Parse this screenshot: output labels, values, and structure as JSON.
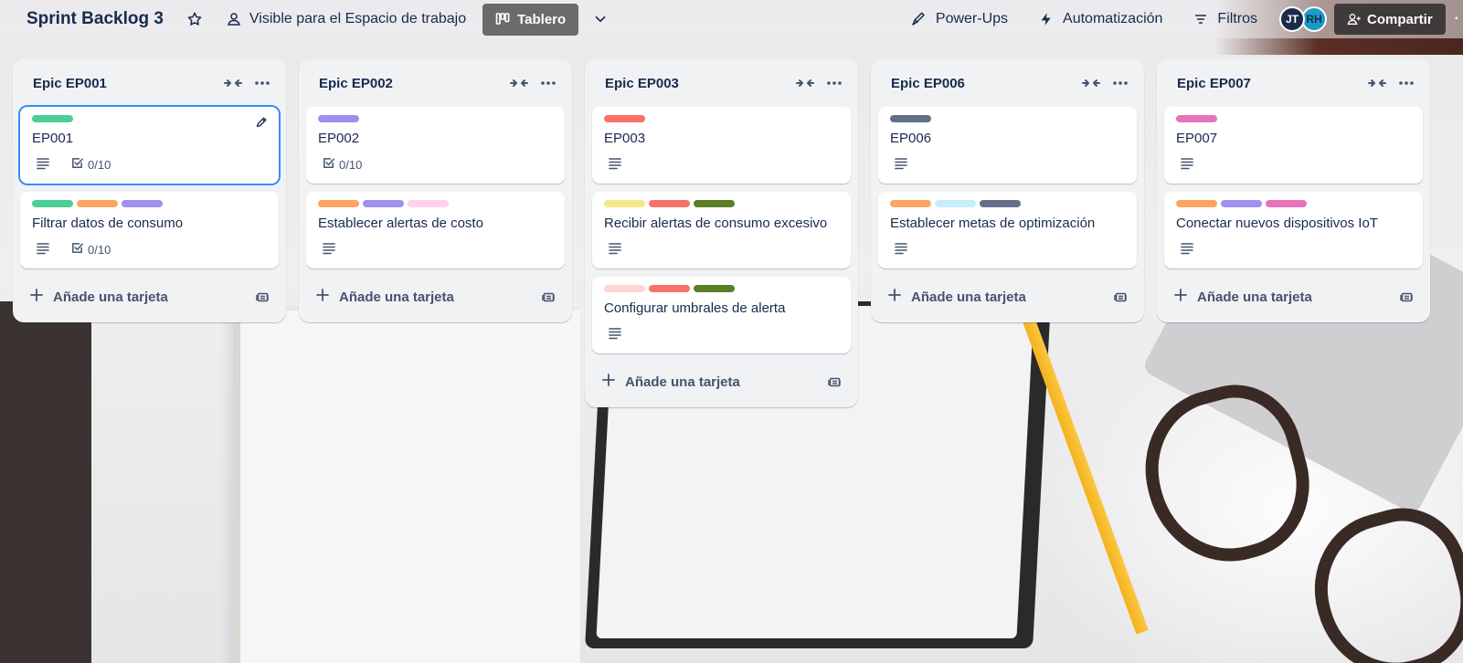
{
  "header": {
    "board_title": "Sprint Backlog 3",
    "visibility_label": "Visible para el Espacio de trabajo",
    "view_label": "Tablero",
    "powerups_label": "Power-Ups",
    "automation_label": "Automatización",
    "filters_label": "Filtros",
    "members": [
      {
        "initials": "JT",
        "color": "#1d2b4a"
      },
      {
        "initials": "RH",
        "color": "#1b9ac8"
      }
    ],
    "share_label": "Compartir"
  },
  "colors": {
    "green": "#4bce97",
    "orange": "#fea362",
    "purple": "#9f8fef",
    "pink_light": "#fdd0ec",
    "red": "#f87168",
    "slate": "#626f86",
    "magenta": "#e774bb",
    "yellow_light": "#f5e989",
    "dark_green": "#5b7f24",
    "sky_light": "#c6edfb",
    "red_light": "#ffd5d2"
  },
  "lists": [
    {
      "title": "Epic EP001",
      "add_card_label": "Añade una tarjeta",
      "cards": [
        {
          "title": "EP001",
          "labels": [
            "#4bce97"
          ],
          "has_description": true,
          "checklist": "0/10",
          "selected": true
        },
        {
          "title": "Filtrar datos de consumo",
          "labels": [
            "#4bce97",
            "#fea362",
            "#9f8fef"
          ],
          "has_description": true,
          "checklist": "0/10"
        }
      ]
    },
    {
      "title": "Epic EP002",
      "add_card_label": "Añade una tarjeta",
      "cards": [
        {
          "title": "EP002",
          "labels": [
            "#9f8fef"
          ],
          "has_description": false,
          "checklist": "0/10"
        },
        {
          "title": "Establecer alertas de costo",
          "labels": [
            "#fea362",
            "#9f8fef",
            "#fdd0ec"
          ],
          "has_description": true
        }
      ]
    },
    {
      "title": "Epic EP003",
      "add_card_label": "Añade una tarjeta",
      "cards": [
        {
          "title": "EP003",
          "labels": [
            "#f87168"
          ],
          "has_description": true
        },
        {
          "title": "Recibir alertas de consumo excesivo",
          "labels": [
            "#f5e989",
            "#f87168",
            "#5b7f24"
          ],
          "has_description": true
        },
        {
          "title": "Configurar umbrales de alerta",
          "labels": [
            "#ffd5d2",
            "#f87168",
            "#5b7f24"
          ],
          "has_description": true
        }
      ]
    },
    {
      "title": "Epic EP006",
      "add_card_label": "Añade una tarjeta",
      "cards": [
        {
          "title": "EP006",
          "labels": [
            "#626f86"
          ],
          "has_description": true
        },
        {
          "title": "Establecer metas de optimización",
          "labels": [
            "#fea362",
            "#c6edfb",
            "#626f86"
          ],
          "has_description": true
        }
      ]
    },
    {
      "title": "Epic EP007",
      "add_card_label": "Añade una tarjeta",
      "cards": [
        {
          "title": "EP007",
          "labels": [
            "#e774bb"
          ],
          "has_description": true
        },
        {
          "title": "Conectar nuevos dispositivos IoT",
          "labels": [
            "#fea362",
            "#9f8fef",
            "#e774bb"
          ],
          "has_description": true
        }
      ]
    }
  ]
}
